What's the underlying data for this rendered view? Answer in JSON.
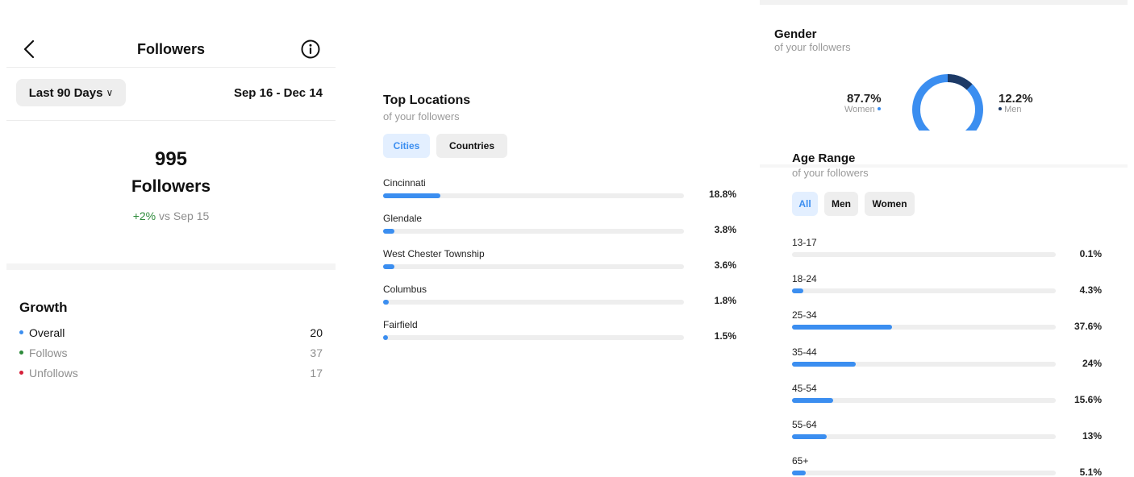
{
  "header": {
    "title": "Followers"
  },
  "filter": {
    "range_label": "Last 90 Days",
    "date_range": "Sep 16 - Dec 14"
  },
  "summary": {
    "count": "995",
    "label": "Followers",
    "change": "+2%",
    "change_suffix": "vs Sep 15"
  },
  "growth": {
    "title": "Growth",
    "items": [
      {
        "label": "Overall",
        "value": "20",
        "color": "#3b8ef0"
      },
      {
        "label": "Follows",
        "value": "37",
        "color": "#2e8b3b"
      },
      {
        "label": "Unfollows",
        "value": "17",
        "color": "#d6203a"
      }
    ]
  },
  "locations": {
    "title": "Top Locations",
    "subtitle": "of your followers",
    "tabs": [
      {
        "label": "Cities",
        "active": true
      },
      {
        "label": "Countries",
        "active": false
      }
    ],
    "items": [
      {
        "name": "Cincinnati",
        "pct": "18.8%",
        "fraction": 0.188
      },
      {
        "name": "Glendale",
        "pct": "3.8%",
        "fraction": 0.038
      },
      {
        "name": "West Chester Township",
        "pct": "3.6%",
        "fraction": 0.036
      },
      {
        "name": "Columbus",
        "pct": "1.8%",
        "fraction": 0.018
      },
      {
        "name": "Fairfield",
        "pct": "1.5%",
        "fraction": 0.015
      }
    ]
  },
  "gender": {
    "title": "Gender",
    "subtitle": "of your followers",
    "women": {
      "pct": "87.7%",
      "label": "Women",
      "fraction": 0.877,
      "color": "#3b8ef0"
    },
    "men": {
      "pct": "12.2%",
      "label": "Men",
      "fraction": 0.122,
      "color": "#1d3a66"
    }
  },
  "age": {
    "title": "Age Range",
    "subtitle": "of your followers",
    "tabs": [
      {
        "label": "All",
        "active": true
      },
      {
        "label": "Men",
        "active": false
      },
      {
        "label": "Women",
        "active": false
      }
    ],
    "items": [
      {
        "name": "13-17",
        "pct": "0.1%",
        "fraction": 0.001
      },
      {
        "name": "18-24",
        "pct": "4.3%",
        "fraction": 0.043
      },
      {
        "name": "25-34",
        "pct": "37.6%",
        "fraction": 0.376
      },
      {
        "name": "35-44",
        "pct": "24%",
        "fraction": 0.24
      },
      {
        "name": "45-54",
        "pct": "15.6%",
        "fraction": 0.156
      },
      {
        "name": "55-64",
        "pct": "13%",
        "fraction": 0.13
      },
      {
        "name": "65+",
        "pct": "5.1%",
        "fraction": 0.051
      }
    ]
  }
}
